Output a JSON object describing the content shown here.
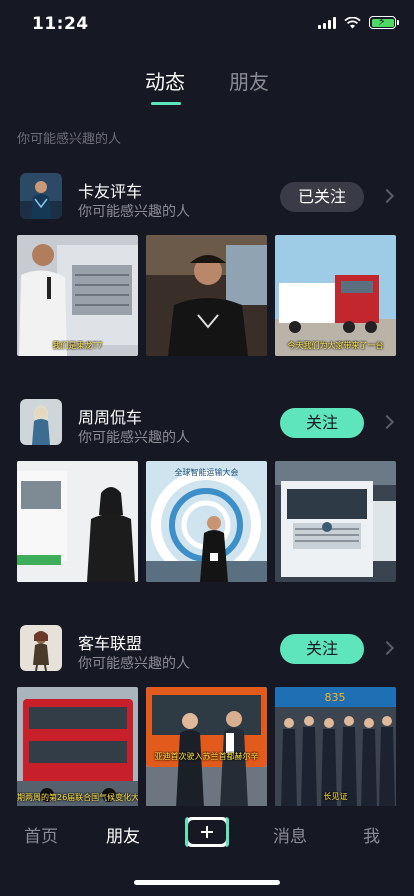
{
  "status_bar": {
    "time": "11:24"
  },
  "top_tabs": [
    {
      "label": "动态",
      "active": true
    },
    {
      "label": "朋友",
      "active": false
    }
  ],
  "section_heading": "你可能感兴趣的人",
  "accounts": [
    {
      "name": "卡友评车",
      "subtitle": "你可能感兴趣的人",
      "follow_label": "已关注",
      "followed": true,
      "thumbnails": [
        {
          "caption": "我们是乘龙T7"
        },
        {
          "caption": ""
        },
        {
          "caption": "今天我们为大家带来了一台"
        }
      ]
    },
    {
      "name": "周周侃车",
      "subtitle": "你可能感兴趣的人",
      "follow_label": "关注",
      "followed": false,
      "thumbnails": [
        {
          "caption": ""
        },
        {
          "caption": "全球智能运输大会"
        },
        {
          "caption": ""
        }
      ]
    },
    {
      "name": "客车联盟",
      "subtitle": "你可能感兴趣的人",
      "follow_label": "关注",
      "followed": false,
      "thumbnails": [
        {
          "caption": "期两周的第26届联合国气候变化大会"
        },
        {
          "caption": "亚迪首次驶入苏兰首都赫尔辛"
        },
        {
          "caption": "长见证"
        }
      ]
    }
  ],
  "bottom_nav": [
    {
      "label": "首页",
      "active": false
    },
    {
      "label": "朋友",
      "active": true
    },
    {
      "label": "消息",
      "active": false
    },
    {
      "label": "我",
      "active": false
    }
  ],
  "colors": {
    "background": "#161823",
    "accent": "#5fe5bc",
    "followed_button": "#3a3b47",
    "muted_text": "#8a8b94"
  }
}
